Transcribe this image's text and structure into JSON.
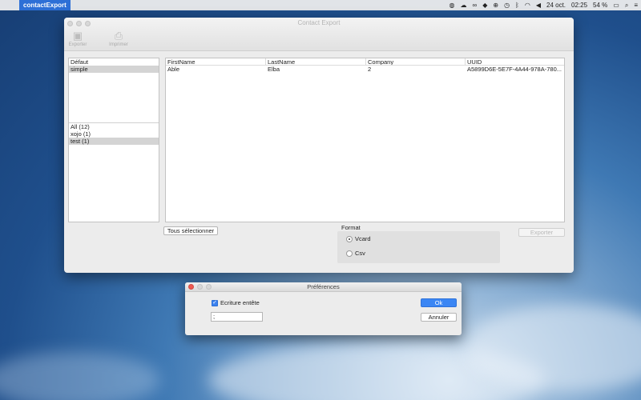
{
  "menubar": {
    "app_name": "contactExport",
    "date": "24 oct.",
    "time": "02:25",
    "battery": "54 %",
    "icons": [
      "apple-icon",
      "status-icon",
      "cloud-icon",
      "glasses-icon",
      "dropbox-icon",
      "globe-icon",
      "time-machine-icon",
      "bluetooth-icon",
      "wifi-icon",
      "volume-icon",
      "battery-icon",
      "search-icon",
      "list-icon"
    ]
  },
  "main_window": {
    "title": "Contact Export",
    "toolbar": {
      "export_label": "Exporter",
      "print_label": "Imprimer"
    },
    "groups_top": [
      "Défaut",
      "simple"
    ],
    "groups_top_selected": 1,
    "groups_bottom": [
      "All (12)",
      "xojo (1)",
      "test (1)"
    ],
    "groups_bottom_selected": 2,
    "table": {
      "columns": [
        "FirstName",
        "LastName",
        "Company",
        "UUID"
      ],
      "rows": [
        [
          "Able",
          "Elba",
          "2",
          "A5899D6E-5E7F-4A44-978A-780..."
        ]
      ]
    },
    "select_all_label": "Tous sélectionner",
    "format_label": "Format",
    "format_options": [
      "Vcard",
      "Csv"
    ],
    "format_selected": "Vcard",
    "export_button_label": "Exporter"
  },
  "prefs_dialog": {
    "title": "Préférences",
    "header_checkbox_label": "Ecriture entête",
    "header_checkbox_checked": true,
    "separator_value": ";",
    "ok_label": "Ok",
    "cancel_label": "Annuler"
  },
  "colors": {
    "accent": "#2d6fd6",
    "close_red": "#ee5a52",
    "ok_button": "#3b86f4"
  }
}
